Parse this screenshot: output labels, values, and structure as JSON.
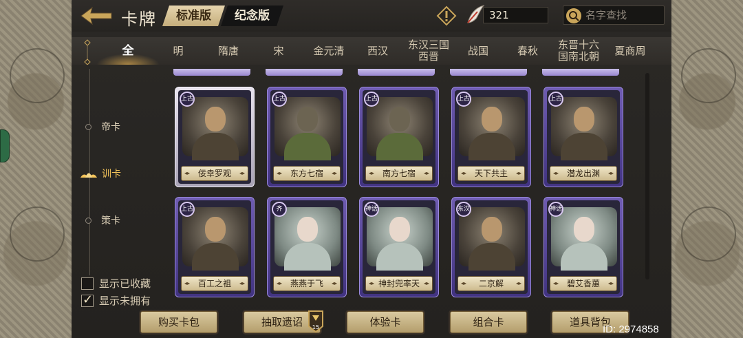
{
  "header": {
    "title": "卡牌",
    "version_tabs": [
      {
        "label": "标准版",
        "active": true
      },
      {
        "label": "纪念版",
        "active": false
      }
    ],
    "currency_value": "321",
    "search_placeholder": "名字查找"
  },
  "dynasties": [
    {
      "label": "全",
      "active": true
    },
    {
      "label": "明"
    },
    {
      "label": "隋唐"
    },
    {
      "label": "宋"
    },
    {
      "label": "金元清"
    },
    {
      "label": "西汉"
    },
    {
      "label": "东汉三国\n西晋"
    },
    {
      "label": "战国"
    },
    {
      "label": "春秋"
    },
    {
      "label": "东晋十六\n国南北朝"
    },
    {
      "label": "夏商周"
    }
  ],
  "categories": [
    {
      "label": "帝卡",
      "active": false
    },
    {
      "label": "训卡",
      "active": true
    },
    {
      "label": "策卡",
      "active": false
    }
  ],
  "filters": [
    {
      "label": "显示已收藏",
      "checked": false
    },
    {
      "label": "显示未拥有",
      "checked": true
    }
  ],
  "cards": [
    {
      "name": "佞幸罗观",
      "badge": "上古",
      "style": "white",
      "portrait": "male"
    },
    {
      "name": "东方七宿",
      "badge": "上古",
      "style": "purple",
      "portrait": "beast"
    },
    {
      "name": "南方七宿",
      "badge": "上古",
      "style": "purple",
      "portrait": "beast"
    },
    {
      "name": "天下共主",
      "badge": "上古",
      "style": "purple",
      "portrait": "male"
    },
    {
      "name": "潜龙出渊",
      "badge": "上古",
      "style": "purple",
      "portrait": "male"
    },
    {
      "name": "百工之祖",
      "badge": "上古",
      "style": "purple",
      "portrait": "male"
    },
    {
      "name": "燕燕于飞",
      "badge": "齐",
      "style": "purple",
      "portrait": "female"
    },
    {
      "name": "神封兜率天",
      "badge": "神话",
      "style": "purple",
      "portrait": "female"
    },
    {
      "name": "二京解",
      "badge": "东汉",
      "style": "purple",
      "portrait": "male"
    },
    {
      "name": "碧艾香蕙",
      "badge": "神话",
      "style": "purple",
      "portrait": "female"
    }
  ],
  "bottom_buttons": [
    "购买卡包",
    "抽取遗诏",
    "体验卡",
    "组合卡",
    "道具背包"
  ],
  "token_count": "15",
  "footer_id": "ID: 2974858"
}
